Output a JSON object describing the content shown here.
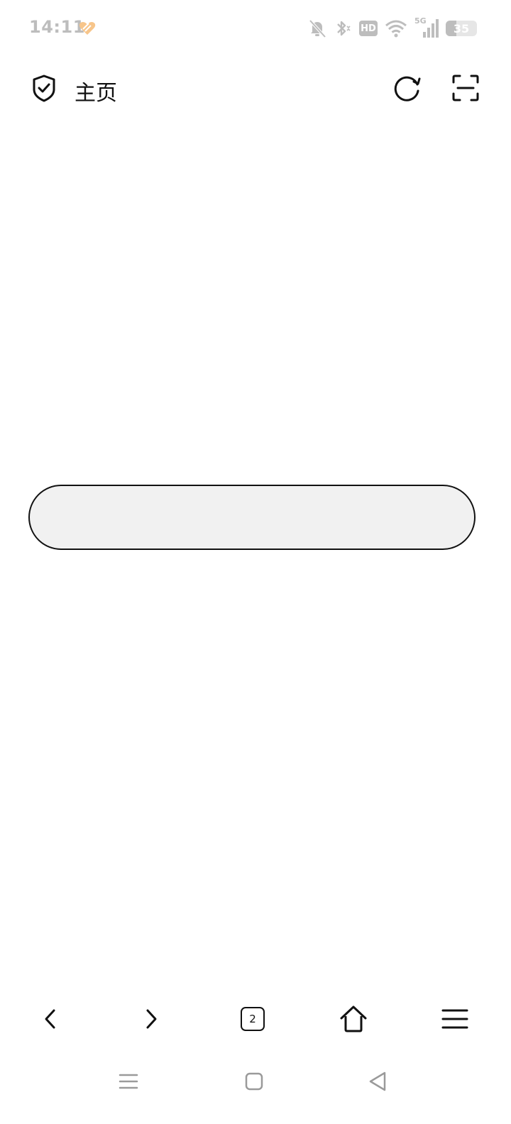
{
  "status_bar": {
    "time": "14:11",
    "network_badge": "HD",
    "network_type": "5G",
    "battery_level": "35",
    "battery_fraction": 0.35,
    "icons": [
      "app-heart-icon",
      "bell-off-icon",
      "bluetooth-icon",
      "hd-icon",
      "wifi-icon",
      "signal-icon",
      "battery-icon"
    ],
    "accent_color": "#f7c58a",
    "muted_color": "#bdbdbd"
  },
  "top_bar": {
    "title": "主页",
    "icons": [
      "shield-check-icon",
      "reload-icon",
      "scan-icon"
    ]
  },
  "search": {
    "value": "",
    "placeholder": ""
  },
  "bottom_bar": {
    "tab_count": "2",
    "icons": [
      "back-icon",
      "forward-icon",
      "tabs-icon",
      "home-icon",
      "menu-icon"
    ]
  },
  "system_nav": {
    "icons": [
      "recents-icon",
      "home-square-icon",
      "back-triangle-icon"
    ]
  }
}
